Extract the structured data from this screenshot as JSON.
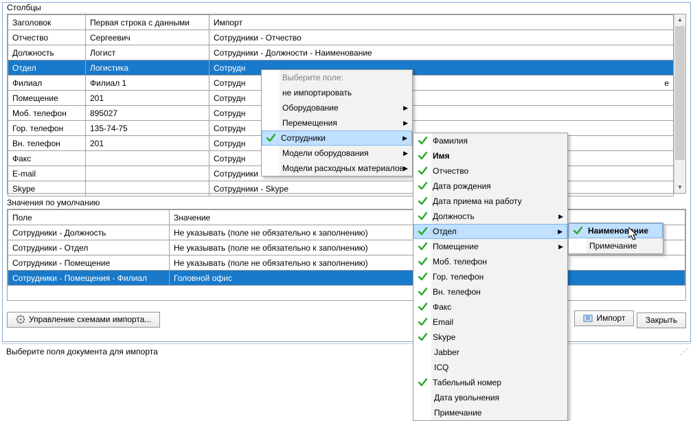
{
  "columns_section": {
    "label": "Столбцы",
    "headers": {
      "h1": "Заголовок",
      "h2": "Первая строка с данными",
      "h3": "Импорт"
    },
    "rows": [
      {
        "h": "Отчество",
        "d": "Сергеевич",
        "i": "Сотрудники - Отчество",
        "sel": false
      },
      {
        "h": "Должность",
        "d": "Логист",
        "i": "Сотрудники - Должности - Наименование",
        "sel": false
      },
      {
        "h": "Отдел",
        "d": "Логистика",
        "i": "Сотрудн",
        "sel": true
      },
      {
        "h": "Филиал",
        "d": "Филиал 1",
        "i": "Сотрудн",
        "tail": "e",
        "sel": false
      },
      {
        "h": "Помещение",
        "d": "201",
        "i": "Сотрудн",
        "sel": false
      },
      {
        "h": "Моб. телефон",
        "d": "895027",
        "i": "Сотрудн",
        "sel": false
      },
      {
        "h": "Гор. телефон",
        "d": "135-74-75",
        "i": "Сотрудн",
        "sel": false
      },
      {
        "h": "Вн. телефон",
        "d": "201",
        "i": "Сотрудн",
        "sel": false
      },
      {
        "h": "Факс",
        "d": "",
        "i": "Сотрудн",
        "sel": false
      },
      {
        "h": "E-mail",
        "d": "",
        "i": "Сотрудники - Email",
        "sel": false
      },
      {
        "h": "Skype",
        "d": "",
        "i": "Сотрудники - Skype",
        "sel": false
      }
    ]
  },
  "defaults_section": {
    "label": "Значения по умолчанию",
    "headers": {
      "h1": "Поле",
      "h2": "Значение"
    },
    "rows": [
      {
        "p": "Сотрудники - Должность",
        "v": "Не указывать (поле не обязательно к заполнению)",
        "sel": false
      },
      {
        "p": "Сотрудники - Отдел",
        "v": "Не указывать (поле не обязательно к заполнению)",
        "sel": false
      },
      {
        "p": "Сотрудники - Помещение",
        "v": "Не указывать (поле не обязательно к заполнению)",
        "sel": false
      },
      {
        "p": "Сотрудники - Помещения - Филиал",
        "v": "Головной офис",
        "sel": true
      }
    ]
  },
  "buttons": {
    "schemes": "Управление схемами импорта...",
    "import": "Импорт",
    "close": "Закрыть"
  },
  "status": "Выберите поля документа для импорта",
  "menu1": {
    "title": "Выберите поле:",
    "items": [
      {
        "label": "не импортировать",
        "sub": false,
        "chk": false,
        "hl": false
      },
      {
        "label": "Оборудование",
        "sub": true,
        "chk": false,
        "hl": false
      },
      {
        "label": "Перемещения",
        "sub": true,
        "chk": false,
        "hl": false
      },
      {
        "label": "Сотрудники",
        "sub": true,
        "chk": true,
        "hl": true
      },
      {
        "label": "Модели оборудования",
        "sub": true,
        "chk": false,
        "hl": false
      },
      {
        "label": "Модели расходных материалов",
        "sub": true,
        "chk": false,
        "hl": false
      }
    ]
  },
  "menu2": {
    "items": [
      {
        "label": "Фамилия",
        "chk": true,
        "sub": false,
        "bold": false,
        "hl": false
      },
      {
        "label": "Имя",
        "chk": true,
        "sub": false,
        "bold": true,
        "hl": false
      },
      {
        "label": "Отчество",
        "chk": true,
        "sub": false,
        "bold": false,
        "hl": false
      },
      {
        "label": "Дата рождения",
        "chk": true,
        "sub": false,
        "bold": false,
        "hl": false
      },
      {
        "label": "Дата приема на работу",
        "chk": true,
        "sub": false,
        "bold": false,
        "hl": false
      },
      {
        "label": "Должность",
        "chk": true,
        "sub": true,
        "bold": false,
        "hl": false
      },
      {
        "label": "Отдел",
        "chk": true,
        "sub": true,
        "bold": false,
        "hl": true
      },
      {
        "label": "Помещение",
        "chk": true,
        "sub": true,
        "bold": false,
        "hl": false
      },
      {
        "label": "Моб. телефон",
        "chk": true,
        "sub": false,
        "bold": false,
        "hl": false
      },
      {
        "label": "Гор. телефон",
        "chk": true,
        "sub": false,
        "bold": false,
        "hl": false
      },
      {
        "label": "Вн. телефон",
        "chk": true,
        "sub": false,
        "bold": false,
        "hl": false
      },
      {
        "label": "Факс",
        "chk": true,
        "sub": false,
        "bold": false,
        "hl": false
      },
      {
        "label": "Email",
        "chk": true,
        "sub": false,
        "bold": false,
        "hl": false
      },
      {
        "label": "Skype",
        "chk": true,
        "sub": false,
        "bold": false,
        "hl": false
      },
      {
        "label": "Jabber",
        "chk": false,
        "sub": false,
        "bold": false,
        "hl": false
      },
      {
        "label": "ICQ",
        "chk": false,
        "sub": false,
        "bold": false,
        "hl": false
      },
      {
        "label": "Табельный номер",
        "chk": true,
        "sub": false,
        "bold": false,
        "hl": false
      },
      {
        "label": "Дата увольнения",
        "chk": false,
        "sub": false,
        "bold": false,
        "hl": false
      },
      {
        "label": "Примечание",
        "chk": false,
        "sub": false,
        "bold": false,
        "hl": false
      }
    ]
  },
  "menu3": {
    "items": [
      {
        "label": "Наименование",
        "chk": true,
        "hl": true,
        "bold": true
      },
      {
        "label": "Примечание",
        "chk": false,
        "hl": false,
        "bold": false
      }
    ]
  }
}
